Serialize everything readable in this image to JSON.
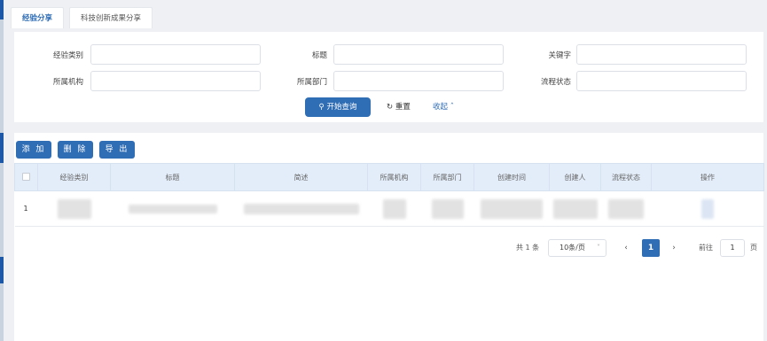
{
  "tabs": [
    "经验分享",
    "科技创新成果分享"
  ],
  "search": {
    "labels": [
      "经验类别",
      "标题",
      "关键字",
      "所属机构",
      "所属部门",
      "流程状态"
    ],
    "values": [
      "",
      "",
      "",
      "",
      "",
      ""
    ],
    "submit": "开始查询",
    "reset": "重置",
    "collapse": "收起"
  },
  "actions": [
    "添 加",
    "删 除",
    "导 出"
  ],
  "table": {
    "headers": [
      "",
      "经验类别",
      "标题",
      "简述",
      "所属机构",
      "所属部门",
      "创建时间",
      "创建人",
      "流程状态",
      "操作"
    ],
    "rows": [
      {
        "index": "1"
      }
    ]
  },
  "pagination": {
    "total": "共 1 条",
    "page_size": "10条/页",
    "prev": "‹",
    "current": "1",
    "next": "›",
    "goto_label": "前往",
    "goto_value": "1",
    "goto_unit": "页"
  },
  "colors": {
    "accent": "#2f6db5",
    "header_bg": "#e3edf9"
  },
  "icons": {
    "search": "search-icon",
    "reset": "refresh-icon",
    "collapse": "chevron-up-icon"
  }
}
